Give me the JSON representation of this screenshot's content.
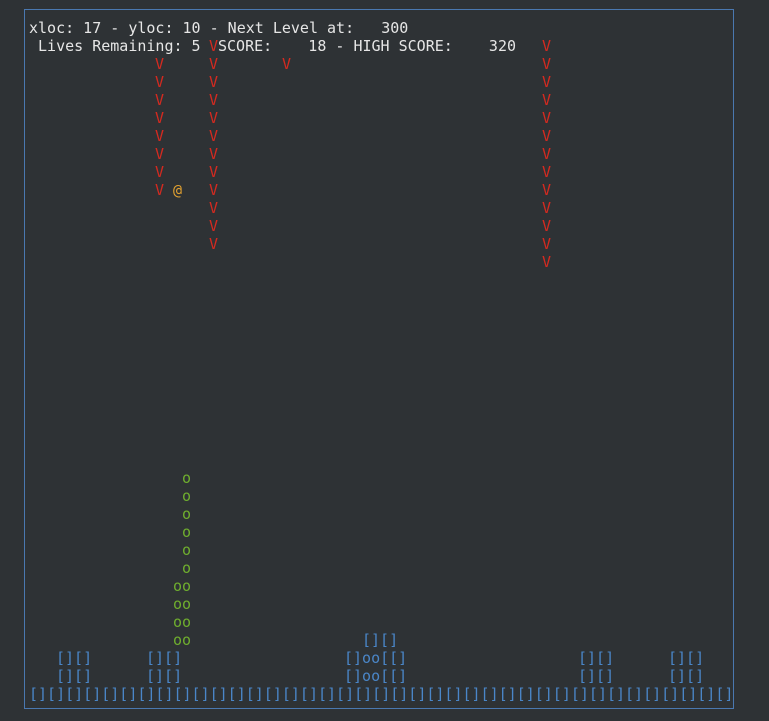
{
  "hud": {
    "line1": "xloc: 17 - yloc: 10 - Next Level at:   300",
    "lives_line": " Lives Remaining: 5 ",
    "score_line": "SCORE:    18 - HIGH SCORE:    320"
  },
  "glyphs": {
    "enemy": "V",
    "player": "@",
    "bullet": "o",
    "bullet_double": "oo",
    "bunker_pair": "[][]",
    "bunker_core": "[]oo[[]"
  },
  "colors": {
    "background": "#2e3235",
    "enemy": "#d42a20",
    "player": "#e0a030",
    "bullet": "#6fae2e",
    "bunker": "#4a86c8",
    "hud": "#e6e6e6"
  },
  "ground": "[][][][][][][][][][][][][][][][][][][][][][][][][][][][][][][][][][][][][][][]"
}
